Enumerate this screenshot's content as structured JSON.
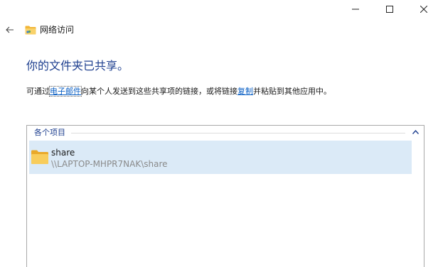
{
  "window": {
    "title": "网络访问",
    "controls": {
      "minimize_icon": "minimize-icon",
      "maximize_icon": "maximize-icon",
      "close_icon": "close-icon"
    }
  },
  "main": {
    "heading": "你的文件夹已共享。",
    "description": {
      "part1": "可通过",
      "email_link": "电子邮件",
      "part2": "向某个人发送到这些共享项的链接，或将链接",
      "copy_link": "复制",
      "part3": "并粘贴到其他应用中。"
    }
  },
  "items": {
    "group_label": "各个项目",
    "entries": [
      {
        "name": "share",
        "path": "\\\\LAPTOP-MHPR7NAK\\share"
      }
    ]
  },
  "colors": {
    "heading": "#1e3f8f",
    "link": "#0a5fc4",
    "selected_row": "#dbeaf7",
    "folder": "#f6c84c"
  }
}
